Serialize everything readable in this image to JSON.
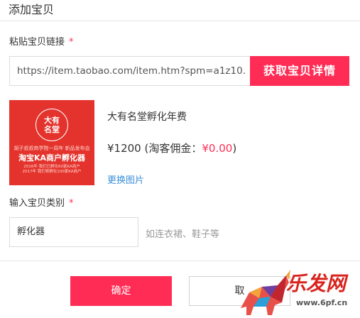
{
  "dialog": {
    "title": "添加宝贝"
  },
  "link_section": {
    "label": "粘贴宝贝链接",
    "required_mark": "*",
    "url_value": "https://item.taobao.com/item.htm?spm=a1z10.",
    "fetch_button": "获取宝贝详情"
  },
  "item": {
    "thumbnail": {
      "logo_text_1": "大有",
      "logo_text_2": "名堂",
      "line1": "胡子叔叔商学院一周年  新品发布会",
      "line2": "淘宝KA商户孵化器",
      "line3a": "2016年 我们已孵化60家KA商户",
      "line3b": "2017年 我们将孵化100家KA商户"
    },
    "name": "大有名堂孵化年费",
    "price": "¥1200",
    "commission_prefix": "(淘客佣金：",
    "commission_value": "¥0.00",
    "commission_suffix": ")",
    "change_image_link": "更换图片"
  },
  "category_section": {
    "label": "输入宝贝类别",
    "required_mark": "*",
    "value": "孵化器",
    "hint": "如连衣裙、鞋子等"
  },
  "footer": {
    "ok_button": "确定",
    "cancel_button": "取"
  },
  "watermark": {
    "text": "乐发网",
    "url": "www.6pf.cn"
  },
  "colors": {
    "accent": "#ff2d55",
    "link": "#3b8fd9",
    "thumbnail_bg": "#e4332c"
  }
}
